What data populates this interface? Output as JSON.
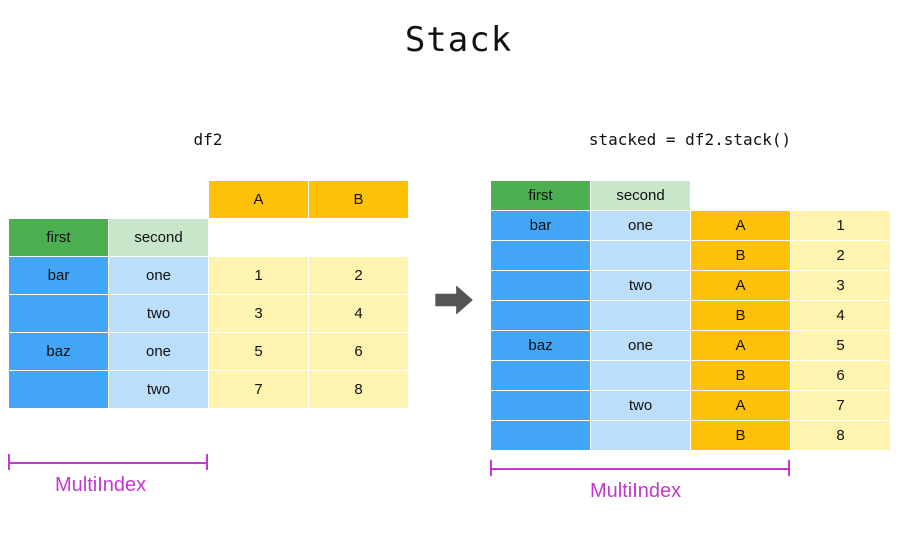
{
  "title": "Stack",
  "left": {
    "caption": "df2",
    "headers": {
      "first": "first",
      "second": "second",
      "A": "A",
      "B": "B"
    },
    "rows": [
      {
        "first": "bar",
        "second": "one",
        "A": "1",
        "B": "2"
      },
      {
        "first": "",
        "second": "two",
        "A": "3",
        "B": "4"
      },
      {
        "first": "baz",
        "second": "one",
        "A": "5",
        "B": "6"
      },
      {
        "first": "",
        "second": "two",
        "A": "7",
        "B": "8"
      }
    ]
  },
  "right": {
    "caption": "stacked = df2.stack()",
    "headers": {
      "first": "first",
      "second": "second"
    },
    "rows": [
      {
        "first": "bar",
        "second": "one",
        "k": "A",
        "v": "1"
      },
      {
        "first": "",
        "second": "",
        "k": "B",
        "v": "2"
      },
      {
        "first": "",
        "second": "two",
        "k": "A",
        "v": "3"
      },
      {
        "first": "",
        "second": "",
        "k": "B",
        "v": "4"
      },
      {
        "first": "baz",
        "second": "one",
        "k": "A",
        "v": "5"
      },
      {
        "first": "",
        "second": "",
        "k": "B",
        "v": "6"
      },
      {
        "first": "",
        "second": "two",
        "k": "A",
        "v": "7"
      },
      {
        "first": "",
        "second": "",
        "k": "B",
        "v": "8"
      }
    ]
  },
  "multiindex_label": "MultiIndex"
}
